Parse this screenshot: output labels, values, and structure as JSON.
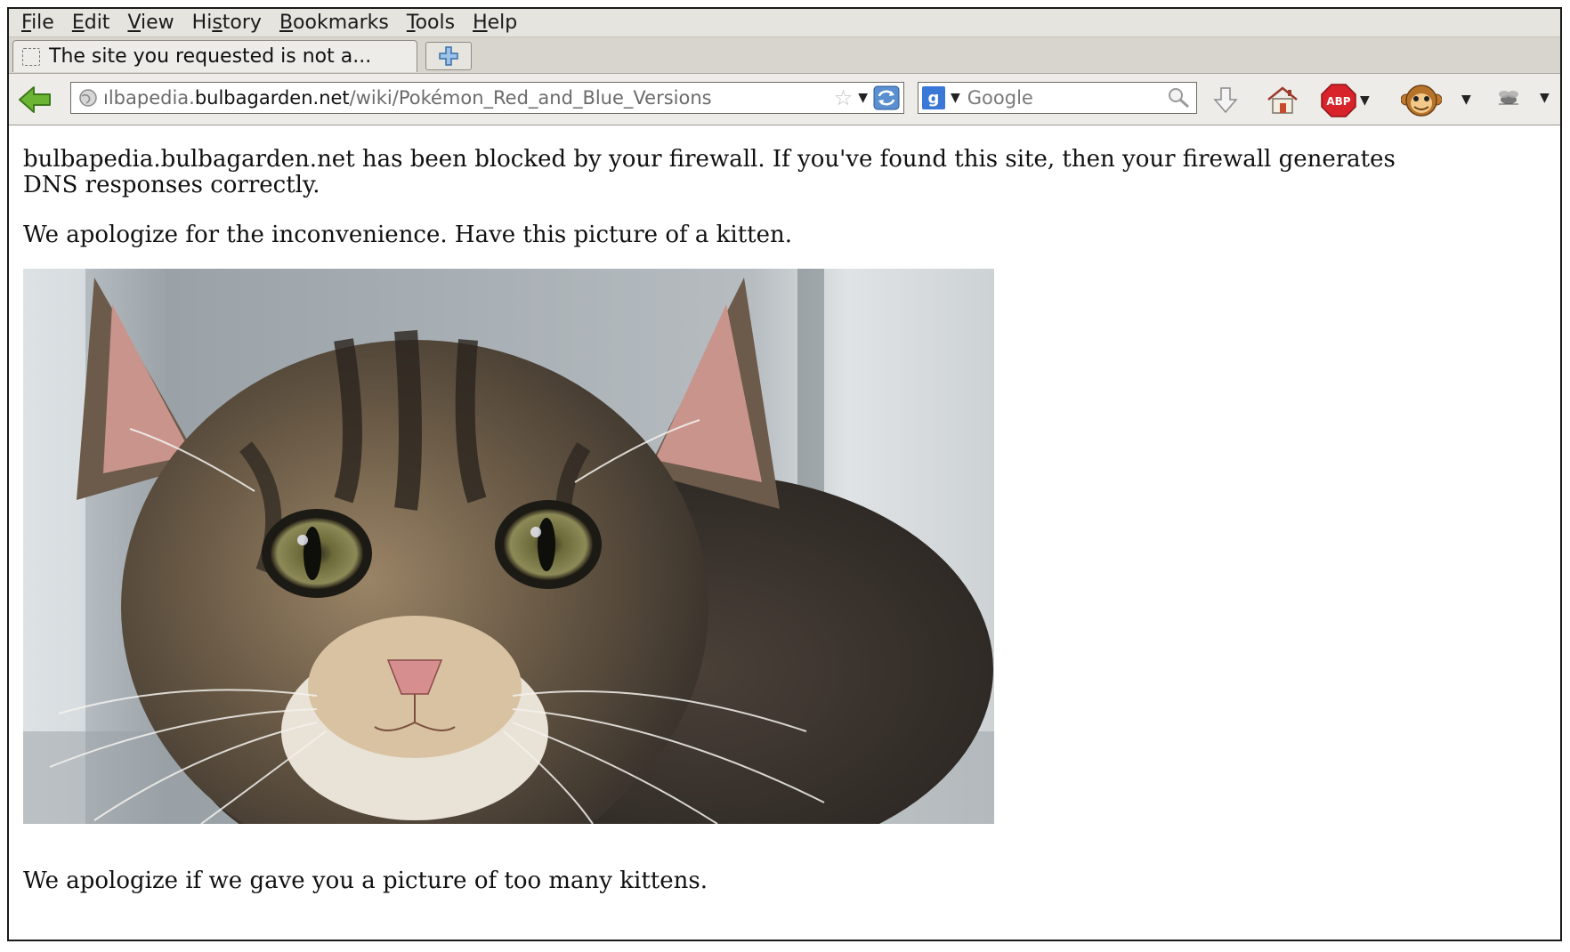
{
  "menubar": {
    "items": [
      {
        "pre": "",
        "u": "F",
        "post": "ile"
      },
      {
        "pre": "",
        "u": "E",
        "post": "dit"
      },
      {
        "pre": "",
        "u": "V",
        "post": "iew"
      },
      {
        "pre": "Hi",
        "u": "s",
        "post": "tory"
      },
      {
        "pre": "",
        "u": "B",
        "post": "ookmarks"
      },
      {
        "pre": "",
        "u": "T",
        "post": "ools"
      },
      {
        "pre": "",
        "u": "H",
        "post": "elp"
      }
    ]
  },
  "tabs": {
    "active_title": "The site you requested is not a...",
    "newtab_icon": "plus-icon"
  },
  "navbar": {
    "url_prefix": "ılbapedia.",
    "url_domain": "bulbagarden.net",
    "url_path": "/wiki/Pokémon_Red_and_Blue_Versions",
    "search_engine_badge": "g",
    "search_placeholder": "Google"
  },
  "toolbar_icons": [
    "back-arrow-icon",
    "globe-icon",
    "star-icon",
    "reload-icon",
    "google-icon",
    "magnifier-icon",
    "download-icon",
    "home-icon",
    "adblock-icon",
    "greasemonkey-icon",
    "extension-icon"
  ],
  "toolbar": {
    "adblock_label": "ABP"
  },
  "content": {
    "para1_line1": "bulbapedia.bulbagarden.net has been blocked by your firewall. If you've found this site, then your firewall generates",
    "para1_line2": "DNS responses correctly.",
    "para2": "We apologize for the inconvenience. Have this picture of a kitten.",
    "para3": "We apologize if we gave you a picture of too many kittens."
  },
  "colors": {
    "menubar_bg": "#e6e4df",
    "back_arrow": "#5aa02c",
    "abp_red": "#d8232a",
    "google_blue": "#3a78d8"
  }
}
